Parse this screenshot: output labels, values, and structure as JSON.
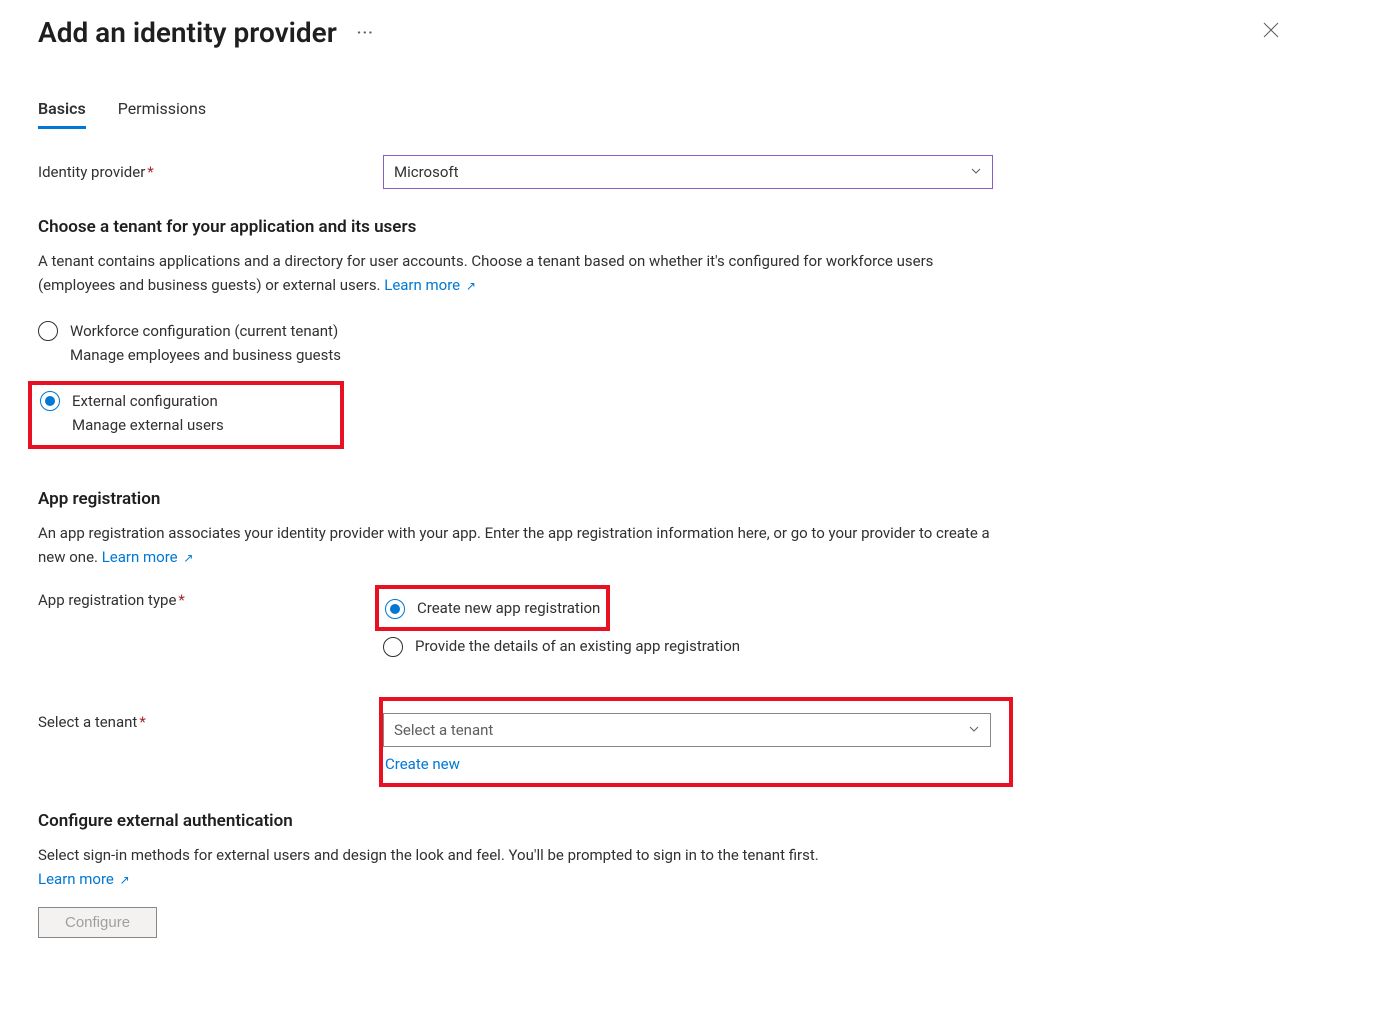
{
  "header": {
    "title": "Add an identity provider"
  },
  "tabs": {
    "basics": "Basics",
    "permissions": "Permissions"
  },
  "identityProvider": {
    "label": "Identity provider",
    "value": "Microsoft"
  },
  "tenantSection": {
    "title": "Choose a tenant for your application and its users",
    "desc": "A tenant contains applications and a directory for user accounts. Choose a tenant based on whether it's configured for workforce users (employees and business guests) or external users. ",
    "learnMore": "Learn more",
    "workforce": {
      "label": "Workforce configuration (current tenant)",
      "sub": "Manage employees and business guests"
    },
    "external": {
      "label": "External configuration",
      "sub": "Manage external users"
    }
  },
  "appReg": {
    "title": "App registration",
    "desc": "An app registration associates your identity provider with your app. Enter the app registration information here, or go to your provider to create a new one. ",
    "learnMore": "Learn more",
    "typeLabel": "App registration type",
    "createNew": "Create new app registration",
    "existing": "Provide the details of an existing app registration"
  },
  "selectTenant": {
    "label": "Select a tenant",
    "placeholder": "Select a tenant",
    "createNew": "Create new"
  },
  "configExt": {
    "title": "Configure external authentication",
    "desc": "Select sign-in methods for external users and design the look and feel. You'll be prompted to sign in to the tenant first.",
    "learnMore": "Learn more",
    "button": "Configure"
  }
}
